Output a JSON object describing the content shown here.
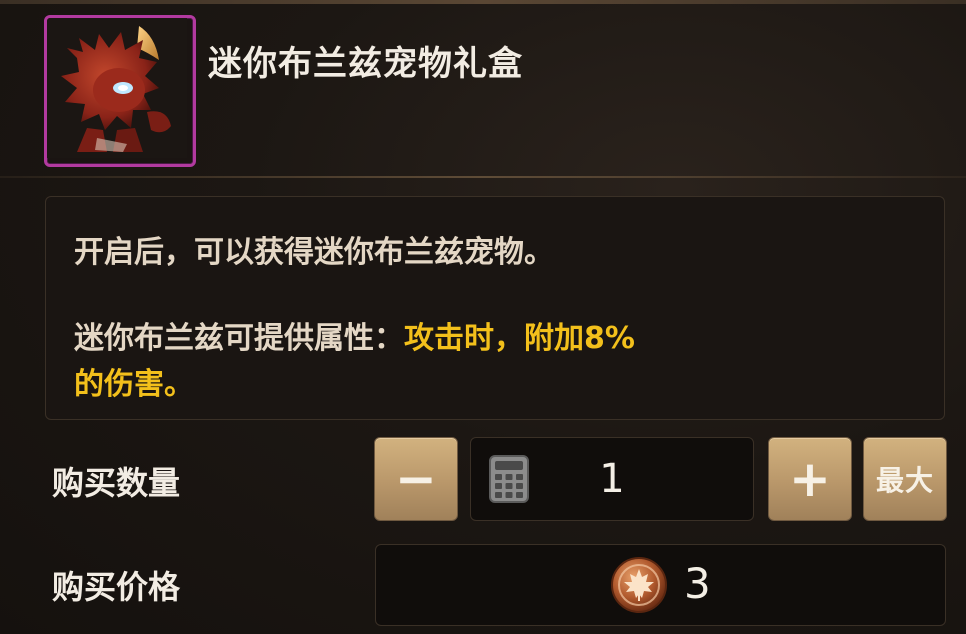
{
  "item": {
    "name": "迷你布兰兹宠物礼盒",
    "icon": "pet-creature-icon",
    "rarity_color": "#b23aa0"
  },
  "description": {
    "line1": "开启后，可以获得迷你布兰兹宠物。",
    "line2_prefix": "迷你布兰兹可提供属性：",
    "line2_highlight": "攻击时，附加8%",
    "line3_highlight": "的伤害。",
    "highlight_color": "#f3c01b"
  },
  "purchase": {
    "quantity_label": "购买数量",
    "quantity_value": "1",
    "minus_label": "−",
    "plus_label": "+",
    "max_label": "最大",
    "calculator_icon": "calculator-icon",
    "price_label": "购买价格",
    "price_value": "3",
    "currency_icon": "maple-leaf-coin-icon"
  }
}
